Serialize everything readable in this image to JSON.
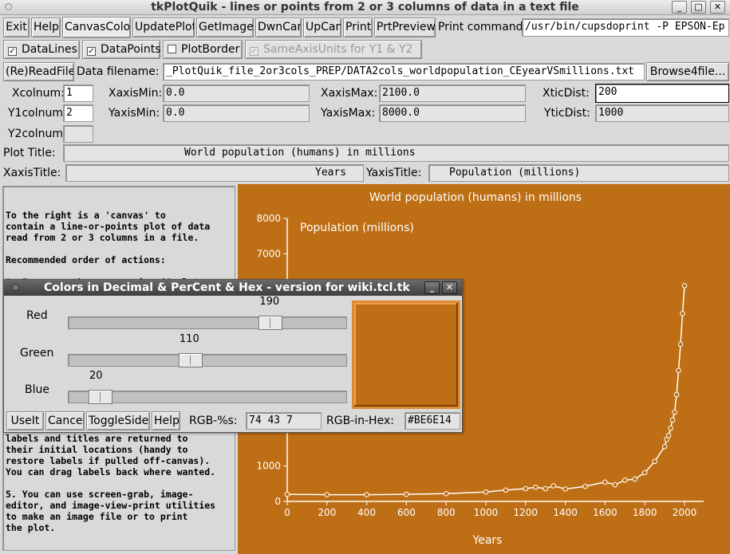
{
  "window": {
    "title": "tkPlotQuik - lines or points from 2 or 3 columns of data in a text file"
  },
  "toolbar": {
    "exit": "Exit",
    "help": "Help",
    "canvas_color": "CanvasColor",
    "update_plot": "UpdatePlot",
    "get_image": "GetImage",
    "dwn_can": "DwnCan",
    "up_can": "UpCan",
    "print": "Print",
    "prt_preview": "PrtPreview",
    "print_command_label": "Print command:",
    "print_command_value": "/usr/bin/cupsdoprint -P EPSON-Ep"
  },
  "options": {
    "data_lines": "DataLines",
    "data_points": "DataPoints",
    "plot_border": "PlotBorder",
    "same_axis_units": "SameAxisUnits for Y1 & Y2",
    "data_lines_checked": true,
    "data_points_checked": true,
    "plot_border_checked": false,
    "same_axis_units_checked": true
  },
  "file": {
    "read_button": "(Re)ReadFile",
    "filename_label": "Data filename:",
    "filename_value": "_PlotQuik_file_2or3cols_PREP/DATA2cols_worldpopulation_CEyearVSmillions.txt",
    "browse_button": "Browse4file..."
  },
  "axes": {
    "xcolnum_label": "Xcolnum:",
    "xcolnum": "1",
    "y1colnum_label": "Y1colnum:",
    "y1colnum": "2",
    "y2colnum_label": "Y2colnum:",
    "y2colnum": "",
    "xaxismin_label": "XaxisMin:",
    "xaxismin": "0.0",
    "yaxismin_label": "YaxisMin:",
    "yaxismin": "0.0",
    "xaxismax_label": "XaxisMax:",
    "xaxismax": "2100.0",
    "yaxismax_label": "YaxisMax:",
    "yaxismax": "8000.0",
    "xticdist_label": "XticDist:",
    "xticdist": "200",
    "yticdist_label": "YticDist:",
    "yticdist": "1000"
  },
  "titles": {
    "plot_title_label": "Plot Title:",
    "plot_title": "World population (humans) in millions",
    "xaxis_title_label": "XaxisTitle:",
    "xaxis_title": "Years",
    "yaxis_title_label": "YaxisTitle:",
    "yaxis_title": "Population (millions)"
  },
  "help_text": {
    "top": "To the right is a 'canvas' to\ncontain a line-or-points plot of data\nread from 2 or 3 columns in a file.\n\nRecommended order of actions:\n\n1. Increase the canvas size (& plot axes\nlength) with the 'UpCan' button. Down-\nsize with 'DwnCan'. Use the 'CanvasColor'",
    "bottom": "labels and titles are returned to\ntheir initial locations (handy to\nrestore labels if pulled off-canvas).\nYou can drag labels back where wanted.\n\n5. You can use screen-grab, image-\neditor, and image-view-print utilities\nto make an image file or to print\nthe plot."
  },
  "dialog": {
    "title": "Colors in Decimal & PerCent & Hex  - version for wiki.tcl.tk",
    "red_label": "Red",
    "green_label": "Green",
    "blue_label": "Blue",
    "red_value": "190",
    "green_value": "110",
    "blue_value": "20",
    "red_fraction": 0.745,
    "green_fraction": 0.431,
    "blue_fraction": 0.078,
    "use_it": "UseIt",
    "cancel": "Cancel",
    "toggle_side": "ToggleSide",
    "help": "Help",
    "rgb_pct_label": "RGB-%s:",
    "rgb_pct_value": "74 43 7",
    "rgb_hex_label": "RGB-in-Hex:",
    "rgb_hex_value": "#BE6E14",
    "swatch_color": "#be6e14"
  },
  "chart_data": {
    "type": "line",
    "title": "World population (humans) in millions",
    "xlabel": "Years",
    "ylabel": "Population (millions)",
    "xlim": [
      0,
      2100
    ],
    "ylim": [
      0,
      8000
    ],
    "xticks": [
      0,
      200,
      400,
      600,
      800,
      1000,
      1200,
      1400,
      1600,
      1800,
      2000
    ],
    "yticks": [
      0,
      1000,
      7000,
      8000
    ],
    "background": "#be6e14",
    "line_color": "#ffffff",
    "x": [
      0,
      200,
      400,
      600,
      800,
      1000,
      1100,
      1200,
      1250,
      1300,
      1340,
      1400,
      1500,
      1600,
      1650,
      1700,
      1750,
      1800,
      1850,
      1900,
      1910,
      1920,
      1930,
      1940,
      1950,
      1960,
      1970,
      1980,
      1990,
      2000
    ],
    "y": [
      200,
      190,
      190,
      200,
      220,
      265,
      320,
      360,
      400,
      360,
      440,
      350,
      425,
      545,
      470,
      600,
      630,
      810,
      1130,
      1550,
      1750,
      1860,
      2070,
      2300,
      2520,
      3020,
      3700,
      4440,
      5310,
      6100
    ]
  }
}
